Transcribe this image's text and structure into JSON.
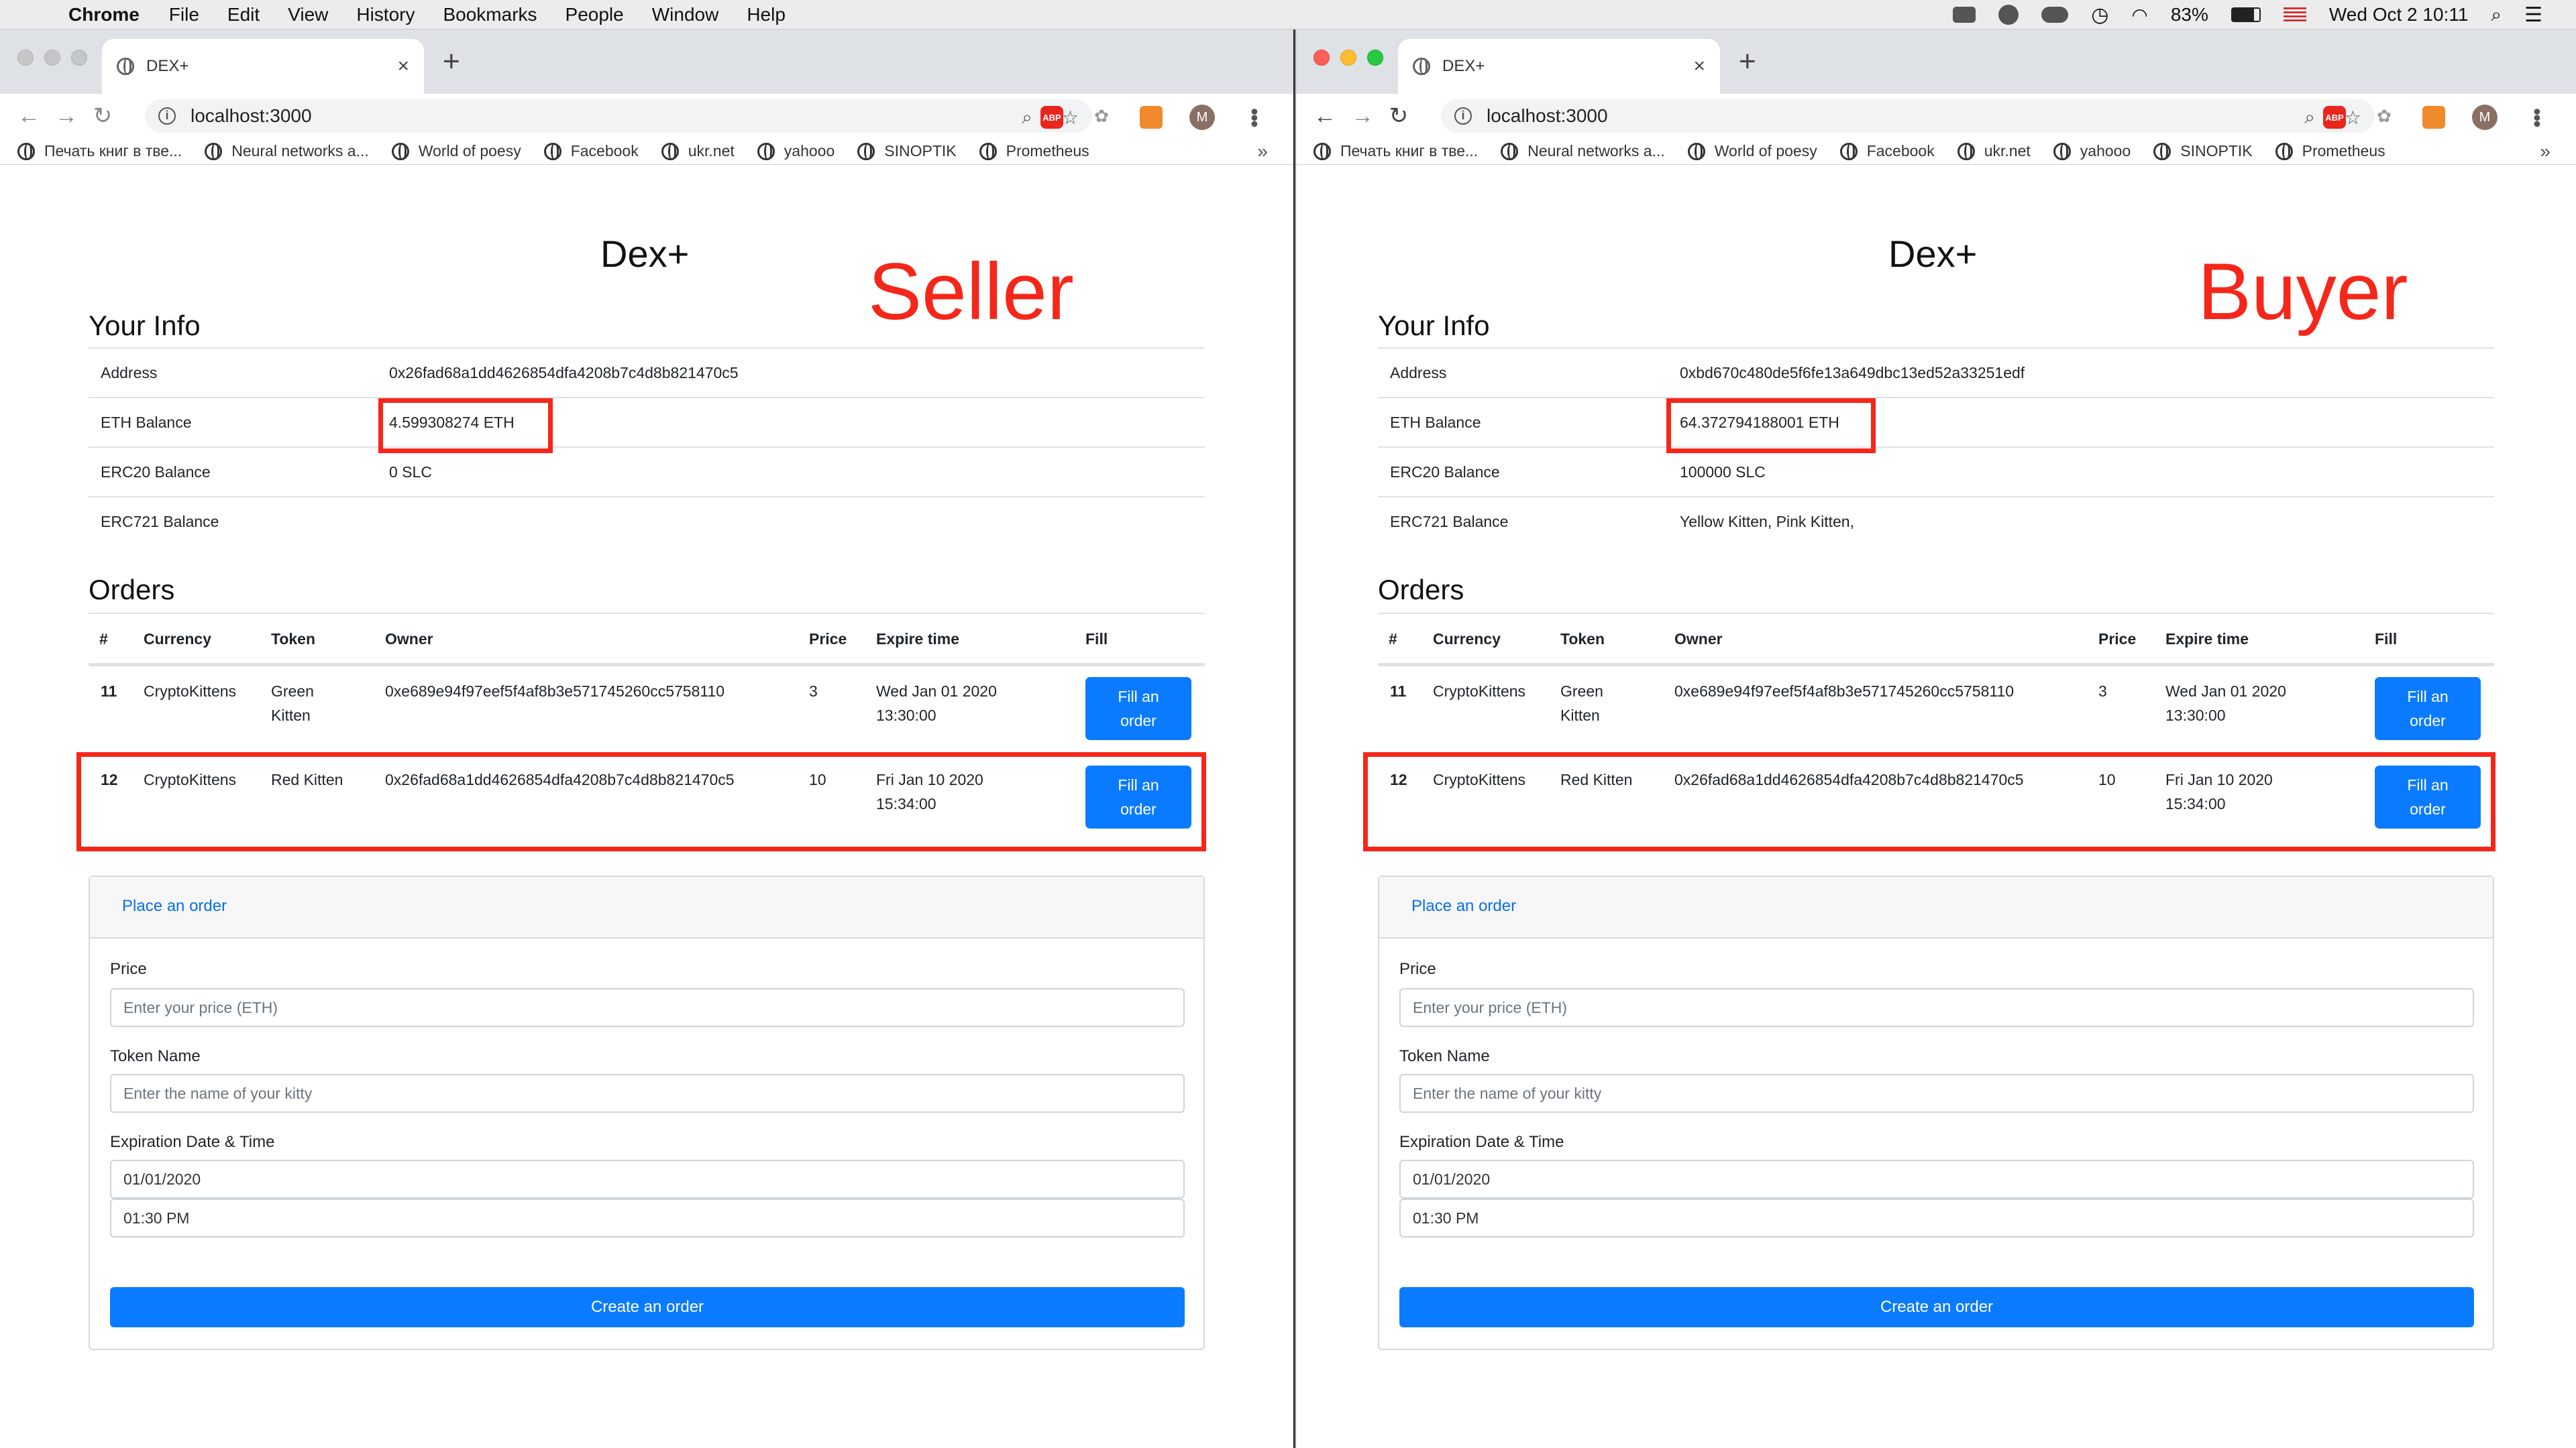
{
  "menubar": {
    "app": "Chrome",
    "menus": [
      "File",
      "Edit",
      "View",
      "History",
      "Bookmarks",
      "People",
      "Window",
      "Help"
    ],
    "battery": "83%",
    "datetime": "Wed Oct 2  10:11"
  },
  "browser": {
    "tab_title": "DEX+",
    "url": "localhost:3000",
    "bookmarks": [
      "Печать книг в тве...",
      "Neural networks a...",
      "World of poesy",
      "Facebook",
      "ukr.net",
      "yahooo",
      "SINOPTIK",
      "Prometheus"
    ],
    "avatar_letter": "M",
    "more": "»"
  },
  "app": {
    "title": "Dex+",
    "your_info": "Your Info",
    "labels": {
      "address": "Address",
      "eth": "ETH Balance",
      "erc20": "ERC20 Balance",
      "erc721": "ERC721 Balance"
    },
    "orders_title": "Orders",
    "columns": [
      "#",
      "Currency",
      "Token",
      "Owner",
      "Price",
      "Expire time",
      "Fill"
    ],
    "orders": [
      {
        "id": "11",
        "currency": "CryptoKittens",
        "token": [
          "Green",
          "Kitten"
        ],
        "owner": "0xe689e94f97eef5f4af8b3e571745260cc5758110",
        "price": "3",
        "expire": [
          "Wed Jan 01 2020",
          "13:30:00"
        ]
      },
      {
        "id": "12",
        "currency": "CryptoKittens",
        "token": [
          "Red Kitten"
        ],
        "owner": "0x26fad68a1dd4626854dfa4208b7c4d8b821470c5",
        "price": "10",
        "expire": [
          "Fri Jan 10 2020",
          "15:34:00"
        ]
      }
    ],
    "fill_button": [
      "Fill an",
      "order"
    ],
    "form": {
      "header": "Place an order",
      "price_label": "Price",
      "price_placeholder": "Enter your price (ETH)",
      "token_label": "Token Name",
      "token_placeholder": "Enter the name of your kitty",
      "exp_label": "Expiration Date & Time",
      "date_value": "01/01/2020",
      "time_value": "01:30 PM",
      "submit": "Create an order"
    }
  },
  "seller": {
    "role_label": "Seller",
    "address": "0x26fad68a1dd4626854dfa4208b7c4d8b821470c5",
    "eth_balance": "4.599308274 ETH",
    "erc20_balance": "0 SLC",
    "erc721_balance": ""
  },
  "buyer": {
    "role_label": "Buyer",
    "address": "0xbd670c480de5f6fe13a649dbc13ed52a33251edf",
    "eth_balance": "64.372794188001 ETH",
    "erc20_balance": "100000 SLC",
    "erc721_balance": "Yellow Kitten, Pink Kitten,"
  },
  "colors": {
    "accent": "#0a7bff",
    "highlight": "#f5271a"
  }
}
